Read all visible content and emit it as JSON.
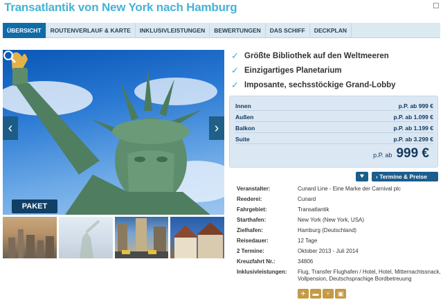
{
  "page": {
    "title": "Transatlantik von New York nach Hamburg"
  },
  "tabs": [
    {
      "label": "ÜBERSICHT",
      "active": true
    },
    {
      "label": "ROUTENVERLAUF & KARTE",
      "active": false
    },
    {
      "label": "INKLUSIVLEISTUNGEN",
      "active": false
    },
    {
      "label": "BEWERTUNGEN",
      "active": false
    },
    {
      "label": "DAS SCHIFF",
      "active": false
    },
    {
      "label": "DECKPLAN",
      "active": false
    }
  ],
  "hero": {
    "badge": "PAKET",
    "prev_arrow": "‹",
    "next_arrow": "›"
  },
  "features": [
    "Größte Bibliothek auf den Weltmeeren",
    "Einzigartiges Planetarium",
    "Imposante, sechsstöckige Grand-Lobby"
  ],
  "prices": {
    "rows": [
      {
        "label": "Innen",
        "value": "p.P. ab 999 €"
      },
      {
        "label": "Außen",
        "value": "p.P. ab 1.099 €"
      },
      {
        "label": "Balkon",
        "value": "p.P. ab 1.199 €"
      },
      {
        "label": "Suite",
        "value": "p.P. ab 3.299 €"
      }
    ],
    "total_prefix": "p.P. ab",
    "total_value": "999 €"
  },
  "actions": {
    "termine_label": "› Termine & Preise"
  },
  "details": [
    {
      "label": "Veranstalter:",
      "value": "Cunard Line - Eine Marke der Carnival plc"
    },
    {
      "label": "Reederei:",
      "value": "Cunard"
    },
    {
      "label": "Fahrgebiet:",
      "value": "Transatlantik"
    },
    {
      "label": "Starthafen:",
      "value": "New York (New York, USA)"
    },
    {
      "label": "Zielhafen:",
      "value": "Hamburg (Deutschland)"
    },
    {
      "label": "Reisedauer:",
      "value": "12 Tage"
    },
    {
      "label": "2 Termine:",
      "value": "Oktober 2013 - Juli 2014"
    },
    {
      "label": "Kreuzfahrt Nr.:",
      "value": "34806"
    },
    {
      "label": "Inklusivleistungen:",
      "value": "Flug, Transfer Flughafen / Hotel, Hotel, Mitternachtssnack, Vollpension, Deutschsprachige Bordbetreuung"
    }
  ],
  "colors": {
    "title": "#44b3d6",
    "tab_active": "#0f6ca8",
    "button": "#1c5d8c",
    "check": "#44a9d4"
  },
  "icons": [
    "plane-icon",
    "bed-icon",
    "dining-icon",
    "bus-icon"
  ]
}
